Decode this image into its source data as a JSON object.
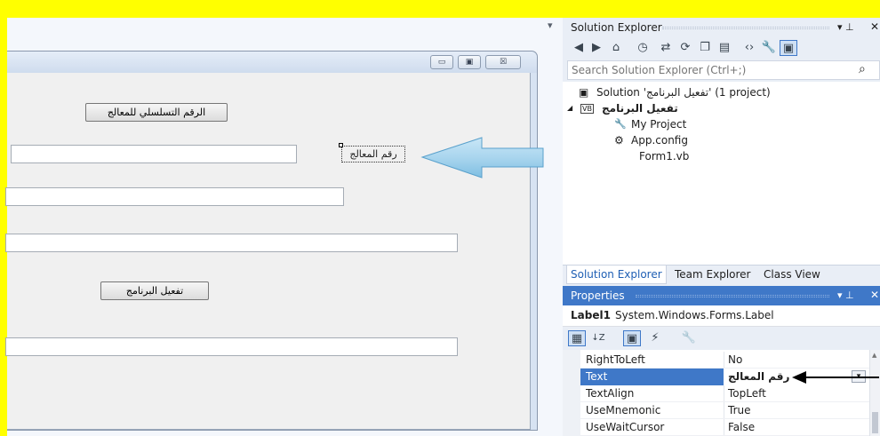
{
  "form_designer": {
    "serial_button_label": "الرقم التسلسلي للمعالج",
    "processor_label_text": "رقم المعالج",
    "activate_button_label": "تفعيل البرنامج",
    "caption_minimize_glyph": "▭",
    "caption_maximize_glyph": "▣",
    "caption_close_glyph": "☒"
  },
  "tab_dropdown_glyph": "▾",
  "solution_explorer": {
    "title": "Solution Explorer",
    "pin_glyph": "▾  ⊥",
    "close_glyph": "✕",
    "toolbar_glyphs": [
      "◀",
      "▶",
      "⌂",
      "◷",
      "⇄",
      "⟳",
      "❐",
      "▤",
      "‹›",
      "🔧",
      "▣"
    ],
    "search_placeholder": "Search Solution Explorer (Ctrl+;)",
    "search_icon_glyph": "⌕",
    "tree": [
      {
        "text": "Solution 'تفعيل البرنامج' (1 project)",
        "icon": "▣",
        "bold": false
      },
      {
        "text": "تفعيل البرنامج",
        "icon": "VB",
        "bold": true,
        "expander": "◢"
      },
      {
        "text": "My Project",
        "icon": "🔧",
        "bold": false
      },
      {
        "text": "App.config",
        "icon": "⚙",
        "bold": false
      },
      {
        "text": "Form1.vb",
        "icon": "",
        "bold": false
      }
    ],
    "tabs": [
      "Solution Explorer",
      "Team Explorer",
      "Class View"
    ]
  },
  "properties": {
    "title": "Properties",
    "pin_glyph": "▾  ⊥",
    "close_glyph": "✕",
    "object_name": "Label1",
    "object_type": "System.Windows.Forms.Label",
    "toolbar_glyphs": [
      "▦",
      "↓Z",
      "▣",
      "⚡",
      "🔧"
    ],
    "rows": [
      {
        "name": "RightToLeft",
        "value": "No"
      },
      {
        "name": "Text",
        "value": "رقم المعالج"
      },
      {
        "name": "TextAlign",
        "value": "TopLeft"
      },
      {
        "name": "UseMnemonic",
        "value": "True"
      },
      {
        "name": "UseWaitCursor",
        "value": "False"
      }
    ],
    "selected_row_index": 1
  },
  "colors": {
    "background": "#ffff00",
    "accent": "#3f78c8",
    "arrow_fill": "#a9d5ee"
  }
}
